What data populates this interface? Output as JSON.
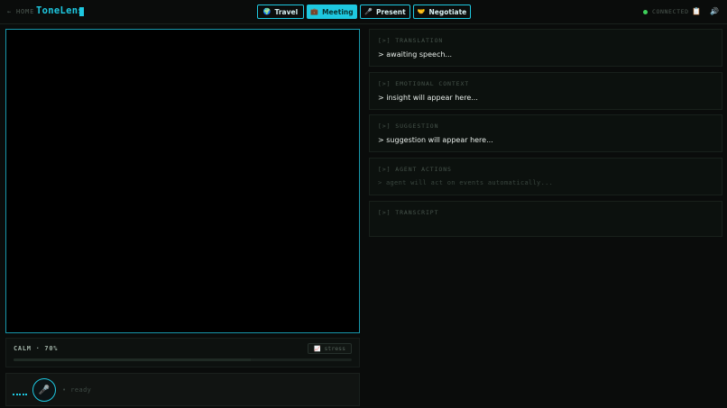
{
  "header": {
    "home_label": "← HOME",
    "app_title": "ToneLens",
    "tabs": [
      {
        "icon": "🌍",
        "label": "Travel",
        "active": false
      },
      {
        "icon": "💼",
        "label": "Meeting",
        "active": true
      },
      {
        "icon": "🎤",
        "label": "Present",
        "active": false
      },
      {
        "icon": "🤝",
        "label": "Negotiate",
        "active": false
      }
    ],
    "status_text": "CONNECTED",
    "status_color": "#3ecf5a",
    "accent_color": "#1ec8e0",
    "notes_icon": "📋",
    "sound_icon": "🔊"
  },
  "mood": {
    "label": "CALM · 70%",
    "level": 0.7,
    "stress_icon": "📈",
    "stress_label": "stress"
  },
  "mic": {
    "icon": "🎤",
    "status": "• ready"
  },
  "panels": [
    {
      "title": "[>] TRANSLATION",
      "body": "> awaiting speech..."
    },
    {
      "title": "[>] EMOTIONAL CONTEXT",
      "body": "> insight will appear here..."
    },
    {
      "title": "[>] SUGGESTION",
      "body": "> suggestion will appear here..."
    },
    {
      "title": "[>] AGENT ACTIONS",
      "body": "> agent will act on events automatically..."
    },
    {
      "title": "[>] TRANSCRIPT",
      "body": ""
    }
  ]
}
